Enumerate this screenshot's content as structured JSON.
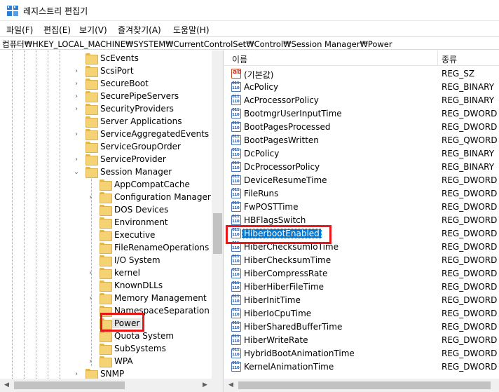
{
  "window": {
    "title": "레지스트리 편집기"
  },
  "menu": [
    {
      "label": "파일(F)"
    },
    {
      "label": "편집(E)"
    },
    {
      "label": "보기(V)"
    },
    {
      "label": "즐겨찾기(A)"
    },
    {
      "label": "도움말(H)"
    }
  ],
  "address": {
    "path": "컴퓨터₩HKEY_LOCAL_MACHINE₩SYSTEM₩CurrentControlSet₩Control₩Session Manager₩Power"
  },
  "tree": {
    "items": [
      {
        "label": "ScEvents",
        "level": 0,
        "expander": ""
      },
      {
        "label": "ScsiPort",
        "level": 0,
        "expander": ">"
      },
      {
        "label": "SecureBoot",
        "level": 0,
        "expander": ">"
      },
      {
        "label": "SecurePipeServers",
        "level": 0,
        "expander": ">"
      },
      {
        "label": "SecurityProviders",
        "level": 0,
        "expander": ">"
      },
      {
        "label": "Server Applications",
        "level": 0,
        "expander": ""
      },
      {
        "label": "ServiceAggregatedEvents",
        "level": 0,
        "expander": ">"
      },
      {
        "label": "ServiceGroupOrder",
        "level": 0,
        "expander": ""
      },
      {
        "label": "ServiceProvider",
        "level": 0,
        "expander": ">"
      },
      {
        "label": "Session Manager",
        "level": 0,
        "expander": "v"
      },
      {
        "label": "AppCompatCache",
        "level": 1,
        "expander": ""
      },
      {
        "label": "Configuration Manager",
        "level": 1,
        "expander": ">"
      },
      {
        "label": "DOS Devices",
        "level": 1,
        "expander": ""
      },
      {
        "label": "Environment",
        "level": 1,
        "expander": ""
      },
      {
        "label": "Executive",
        "level": 1,
        "expander": ""
      },
      {
        "label": "FileRenameOperations",
        "level": 1,
        "expander": ""
      },
      {
        "label": "I/O System",
        "level": 1,
        "expander": ""
      },
      {
        "label": "kernel",
        "level": 1,
        "expander": ">"
      },
      {
        "label": "KnownDLLs",
        "level": 1,
        "expander": ""
      },
      {
        "label": "Memory Management",
        "level": 1,
        "expander": ">"
      },
      {
        "label": "NamespaceSeparation",
        "level": 1,
        "expander": ""
      },
      {
        "label": "Power",
        "level": 1,
        "expander": "",
        "selected": true
      },
      {
        "label": "Quota System",
        "level": 1,
        "expander": ""
      },
      {
        "label": "SubSystems",
        "level": 1,
        "expander": ""
      },
      {
        "label": "WPA",
        "level": 1,
        "expander": ">"
      },
      {
        "label": "SNMP",
        "level": 0,
        "expander": ">"
      }
    ]
  },
  "list": {
    "columns": {
      "name": "이름",
      "type": "종류"
    },
    "rows": [
      {
        "name": "(기본값)",
        "type": "REG_SZ",
        "icon": "string-value-icon"
      },
      {
        "name": "AcPolicy",
        "type": "REG_BINARY",
        "icon": "binary-value-icon"
      },
      {
        "name": "AcProcessorPolicy",
        "type": "REG_BINARY",
        "icon": "binary-value-icon"
      },
      {
        "name": "BootmgrUserInputTime",
        "type": "REG_DWORD",
        "icon": "binary-value-icon"
      },
      {
        "name": "BootPagesProcessed",
        "type": "REG_DWORD",
        "icon": "binary-value-icon"
      },
      {
        "name": "BootPagesWritten",
        "type": "REG_QWORD",
        "icon": "binary-value-icon"
      },
      {
        "name": "DcPolicy",
        "type": "REG_BINARY",
        "icon": "binary-value-icon"
      },
      {
        "name": "DcProcessorPolicy",
        "type": "REG_BINARY",
        "icon": "binary-value-icon"
      },
      {
        "name": "DeviceResumeTime",
        "type": "REG_DWORD",
        "icon": "binary-value-icon"
      },
      {
        "name": "FileRuns",
        "type": "REG_DWORD",
        "icon": "binary-value-icon"
      },
      {
        "name": "FwPOSTTime",
        "type": "REG_DWORD",
        "icon": "binary-value-icon"
      },
      {
        "name": "HBFlagsSwitch",
        "type": "REG_DWORD",
        "icon": "binary-value-icon"
      },
      {
        "name": "HiberbootEnabled",
        "type": "REG_DWORD",
        "icon": "binary-value-icon",
        "selected": true
      },
      {
        "name": "HiberChecksumIoTime",
        "type": "REG_DWORD",
        "icon": "binary-value-icon"
      },
      {
        "name": "HiberChecksumTime",
        "type": "REG_DWORD",
        "icon": "binary-value-icon"
      },
      {
        "name": "HiberCompressRate",
        "type": "REG_DWORD",
        "icon": "binary-value-icon"
      },
      {
        "name": "HiberHiberFileTime",
        "type": "REG_DWORD",
        "icon": "binary-value-icon"
      },
      {
        "name": "HiberInitTime",
        "type": "REG_DWORD",
        "icon": "binary-value-icon"
      },
      {
        "name": "HiberIoCpuTime",
        "type": "REG_DWORD",
        "icon": "binary-value-icon"
      },
      {
        "name": "HiberSharedBufferTime",
        "type": "REG_DWORD",
        "icon": "binary-value-icon"
      },
      {
        "name": "HiberWriteRate",
        "type": "REG_DWORD",
        "icon": "binary-value-icon"
      },
      {
        "name": "HybridBootAnimationTime",
        "type": "REG_DWORD",
        "icon": "binary-value-icon"
      },
      {
        "name": "KernelAnimationTime",
        "type": "REG_DWORD",
        "icon": "binary-value-icon"
      }
    ]
  },
  "colors": {
    "selection": "#0078d7",
    "annotation": "#e8181a",
    "folder": "#f5d274"
  }
}
